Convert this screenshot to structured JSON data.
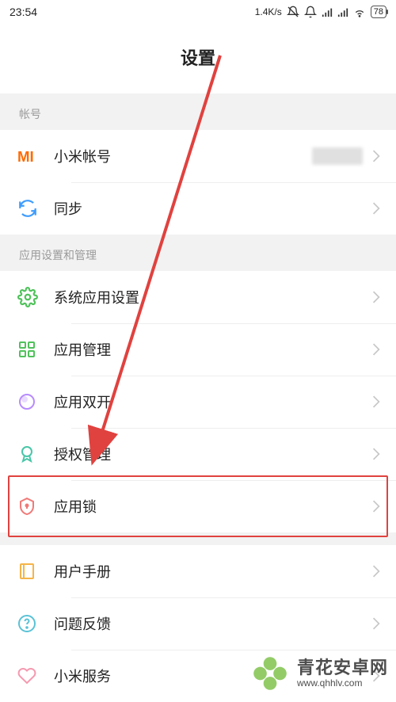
{
  "status": {
    "time": "23:54",
    "net_speed": "1.4K/s",
    "battery": "78"
  },
  "title": "设置",
  "sections": [
    {
      "header": "帐号",
      "rows": [
        {
          "key": "mi-account",
          "label": "小米帐号",
          "icon": "mi-logo",
          "value_blurred": true
        },
        {
          "key": "sync",
          "label": "同步",
          "icon": "sync"
        }
      ]
    },
    {
      "header": "应用设置和管理",
      "rows": [
        {
          "key": "system-apps",
          "label": "系统应用设置",
          "icon": "gear"
        },
        {
          "key": "app-manage",
          "label": "应用管理",
          "icon": "grid"
        },
        {
          "key": "dual-apps",
          "label": "应用双开",
          "icon": "circle"
        },
        {
          "key": "authorization",
          "label": "授权管理",
          "icon": "badge"
        },
        {
          "key": "app-lock",
          "label": "应用锁",
          "icon": "shield-lock",
          "highlighted": true
        }
      ]
    },
    {
      "header": "",
      "rows": [
        {
          "key": "user-manual",
          "label": "用户手册",
          "icon": "book"
        },
        {
          "key": "feedback",
          "label": "问题反馈",
          "icon": "question"
        },
        {
          "key": "mi-service",
          "label": "小米服务",
          "icon": "heart"
        }
      ]
    }
  ],
  "watermark": {
    "title": "青花安卓网",
    "url": "www.qhhlv.com"
  },
  "colors": {
    "accent_orange": "#ff6a00",
    "accent_blue": "#3d9cff",
    "accent_green": "#4fc25a",
    "accent_purple": "#b78bff",
    "accent_teal": "#49c6a8",
    "accent_red": "#f07a78",
    "accent_yellow": "#f5b547",
    "accent_cyan": "#5ac2d6",
    "accent_pink": "#f59ab0",
    "highlight_red": "#e0423f",
    "wm_green": "#6ab92e"
  }
}
